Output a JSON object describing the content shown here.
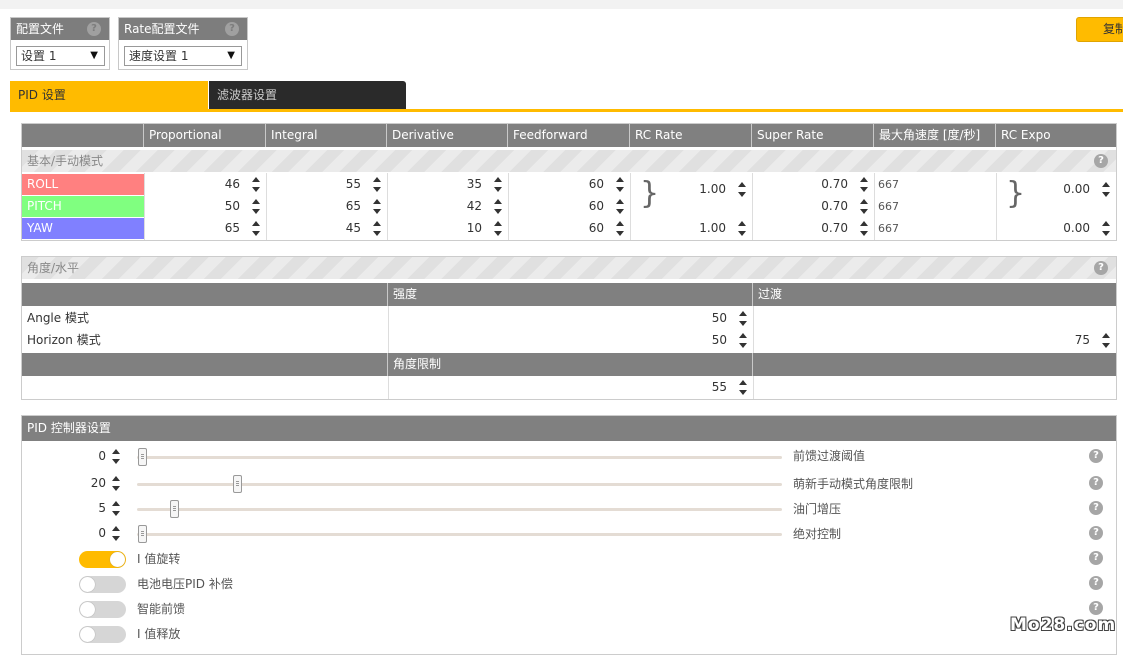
{
  "profile": {
    "title": "配置文件",
    "value": "设置 1"
  },
  "rate_profile": {
    "title": "Rate配置文件",
    "value": "速度设置 1"
  },
  "copy_button": "复制",
  "tabs": [
    "PID 设置",
    "滤波器设置"
  ],
  "pid_table": {
    "headers": [
      "Proportional",
      "Integral",
      "Derivative",
      "Feedforward",
      "RC Rate",
      "Super Rate",
      "最大角速度 [度/秒]",
      "RC Expo"
    ],
    "section": "基本/手动模式",
    "rows": [
      {
        "axis": "ROLL",
        "color": "#ff8080",
        "p": "46",
        "i": "55",
        "d": "35",
        "ff": "60",
        "super_rate": "0.70",
        "max_rate": "667"
      },
      {
        "axis": "PITCH",
        "color": "#80ff80",
        "p": "50",
        "i": "65",
        "d": "42",
        "ff": "60",
        "super_rate": "0.70",
        "max_rate": "667"
      },
      {
        "axis": "YAW",
        "color": "#8080ff",
        "p": "65",
        "i": "45",
        "d": "10",
        "ff": "60",
        "super_rate": "0.70",
        "max_rate": "667"
      }
    ],
    "rc_rate_rp": "1.00",
    "rc_rate_yaw": "1.00",
    "rc_expo_rp": "0.00",
    "rc_expo_yaw": "0.00"
  },
  "angle": {
    "title": "角度/水平",
    "strength_header": "强度",
    "transition_header": "过渡",
    "angle_label": "Angle 模式",
    "horizon_label": "Horizon 模式",
    "angle_strength": "50",
    "horizon_strength": "50",
    "horizon_transition": "75",
    "limit_header": "角度限制",
    "angle_limit": "55"
  },
  "pid_controller": {
    "title": "PID 控制器设置",
    "sliders": [
      {
        "value": "0",
        "label": "前馈过渡阈值",
        "level": 0.0
      },
      {
        "value": "20",
        "label": "萌新手动模式角度限制",
        "level": 0.15
      },
      {
        "value": "5",
        "label": "油门增压",
        "level": 0.05
      },
      {
        "value": "0",
        "label": "绝对控制",
        "level": 0.0
      }
    ],
    "toggles": [
      {
        "label": "I 值旋转",
        "on": true
      },
      {
        "label": "电池电压PID 补偿",
        "on": false
      },
      {
        "label": "智能前馈",
        "on": false
      },
      {
        "label": "I 值释放",
        "on": false
      }
    ]
  },
  "watermark": "Mo28.com",
  "help_glyph": "?"
}
